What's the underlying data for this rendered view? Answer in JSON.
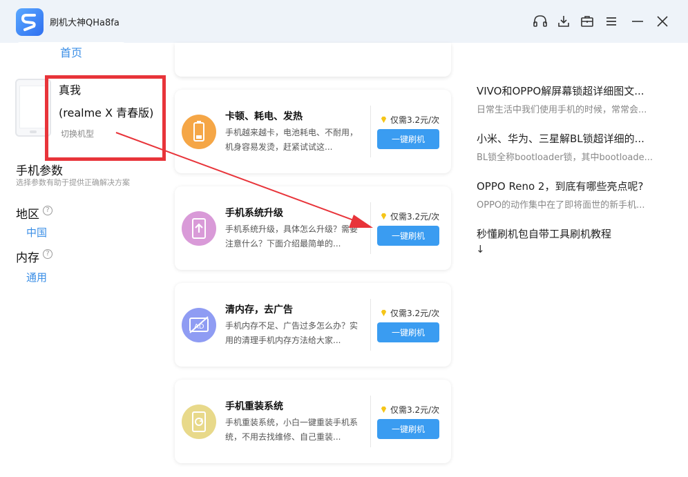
{
  "app": {
    "title": "刷机大神QHa8fa"
  },
  "titlebar": {
    "icons": [
      "headphones-icon",
      "download-icon",
      "toolbox-icon",
      "menu-icon",
      "minimize-icon",
      "close-icon"
    ]
  },
  "tabs": [
    {
      "label": "首页"
    }
  ],
  "device": {
    "brand": "真我",
    "model": "(realme X 青春版)",
    "switch_label": "切换机型"
  },
  "params": {
    "title": "手机参数",
    "subtitle": "选择参数有助于提供正确解决方案",
    "fields": [
      {
        "label": "地区",
        "help": "?",
        "value": "中国"
      },
      {
        "label": "内存",
        "help": "?",
        "value": "通用"
      }
    ]
  },
  "cards": [
    {
      "icon": "battery-icon",
      "icon_color": "#f5a646",
      "title": "卡顿、耗电、发热",
      "desc": "手机越来越卡，电池耗电、不耐用，机身容易发烫，赶紧试试这...",
      "price": "仅需3.2元/次",
      "button": "一键刷机"
    },
    {
      "icon": "system-upgrade-icon",
      "icon_color": "#d99ad8",
      "title": "手机系统升级",
      "desc": "手机系统升级，具体怎么升级？需要注意什么？下面介绍最简单的...",
      "price": "仅需3.2元/次",
      "button": "一键刷机"
    },
    {
      "icon": "no-ads-icon",
      "icon_color": "#8f9cf3",
      "title": "清内存，去广告",
      "desc": "手机内存不足、广告过多怎么办？实用的清理手机内存方法给大家...",
      "price": "仅需3.2元/次",
      "button": "一键刷机"
    },
    {
      "icon": "reinstall-icon",
      "icon_color": "#e8d98a",
      "title": "手机重装系统",
      "desc": "手机重装系统，小白一键重装手机系统，不用去找维修、自己重装...",
      "price": "仅需3.2元/次",
      "button": "一键刷机"
    }
  ],
  "articles": [
    {
      "title": "VIVO和OPPO解屏幕锁超详细图文...",
      "desc": "日常生活中我们使用手机的时候，常常会..."
    },
    {
      "title": "小米、华为、三星解BL锁超详细的...",
      "desc": "BL锁全称bootloader锁，其中bootloade..."
    },
    {
      "title": "OPPO Reno 2，到底有哪些亮点呢?",
      "desc": "OPPO的动作集中在了即将面世的新手机..."
    },
    {
      "title": "秒懂刷机包自带工具刷机教程",
      "desc": ""
    }
  ],
  "article_more": "↓",
  "colors": {
    "accent": "#3a9cf1",
    "annotation": "#e8343a"
  }
}
